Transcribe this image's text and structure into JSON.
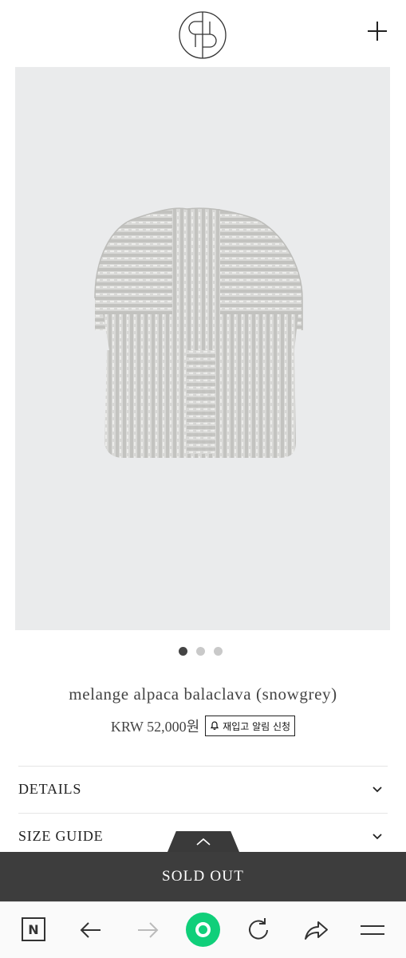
{
  "product": {
    "name": "melange alpaca balaclava (snowgrey)",
    "price": "KRW 52,000원",
    "restock_label": "재입고 알림 신청"
  },
  "gallery": {
    "slide_count": 3,
    "active_index": 0
  },
  "sections": {
    "details": "DETAILS",
    "size_guide": "SIZE GUIDE"
  },
  "cta": {
    "sold_out": "SOLD OUT"
  },
  "browser": {
    "n_label": "N"
  },
  "icons": [
    "brand-logo-icon",
    "plus-icon",
    "bell-icon",
    "chevron-down-icon",
    "chevron-up-icon",
    "back-arrow-icon",
    "forward-arrow-icon",
    "reload-icon",
    "share-icon",
    "menu-icon"
  ],
  "colors": {
    "accent_green": "#10cf7a",
    "sold_out_bar": "#3d3d3d"
  }
}
